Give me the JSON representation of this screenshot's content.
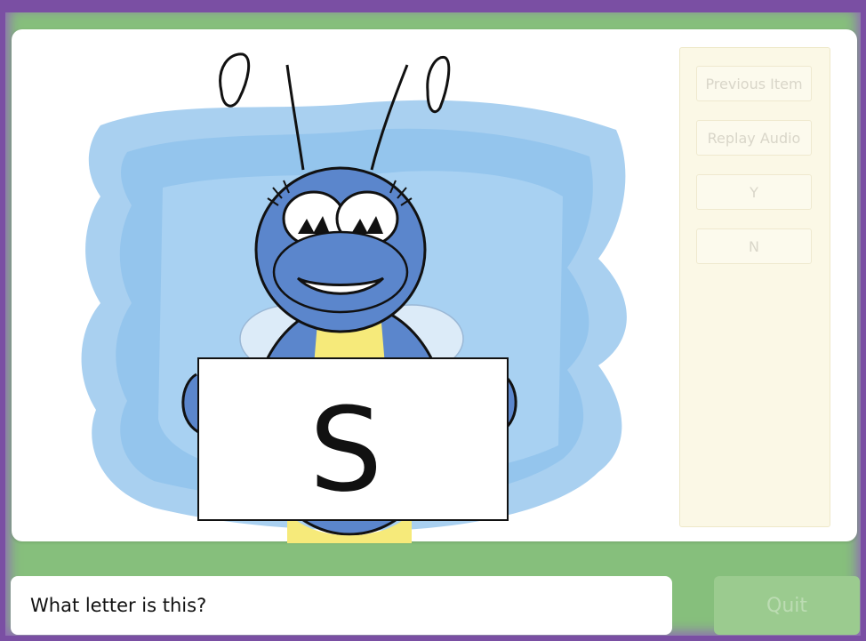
{
  "illustration": {
    "card_letter": "S"
  },
  "panel": {
    "buttons": [
      {
        "label": "Previous Item"
      },
      {
        "label": "Replay Audio"
      },
      {
        "label": "Y"
      },
      {
        "label": "N"
      }
    ]
  },
  "prompt": {
    "text": "What letter is this?"
  },
  "footer": {
    "quit_label": "Quit"
  },
  "colors": {
    "frame_green": "#86bf7c",
    "border_purple": "#7a4fa3",
    "paint_blue": "#8fc2ec",
    "bug_blue": "#5b86cc",
    "bug_yellow": "#f6ea7a",
    "panel_bg": "#fbf8e6"
  }
}
